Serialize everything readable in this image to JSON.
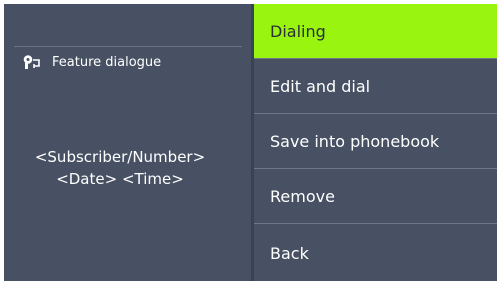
{
  "dialog": {
    "title": "Feature dialogue",
    "subscriber": "<Subscriber/Number>",
    "datetime": "<Date> <Time>"
  },
  "menu": {
    "items": [
      {
        "label": "Dialing",
        "selected": true
      },
      {
        "label": "Edit and dial",
        "selected": false
      },
      {
        "label": "Save into phonebook",
        "selected": false
      },
      {
        "label": "Remove",
        "selected": false
      },
      {
        "label": "Back",
        "selected": false
      }
    ]
  },
  "colors": {
    "background": "#475163",
    "selection": "#99f40f",
    "text": "#ffffff"
  },
  "icons": {
    "feature": "feature-dialogue-icon"
  }
}
